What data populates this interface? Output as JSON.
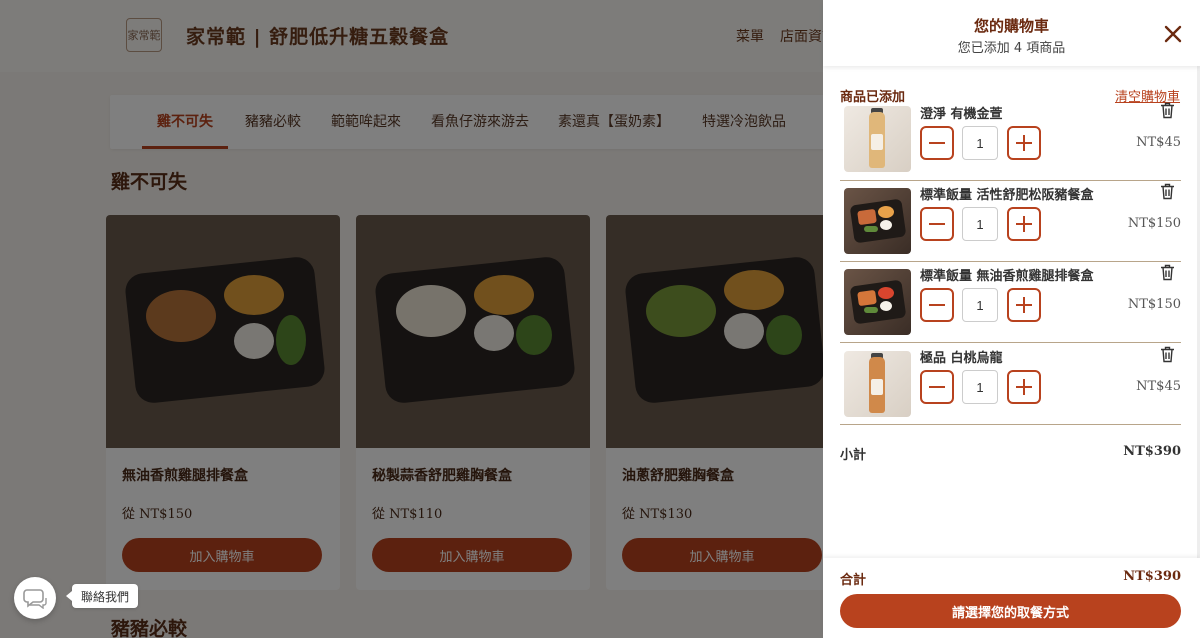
{
  "site": {
    "title": "家常範 | 舒肥低升糖五穀餐盒",
    "logo_text": "家常範",
    "nav": [
      "菜單",
      "店面資訊"
    ]
  },
  "category_tabs": [
    {
      "label": "雞不可失",
      "active": true
    },
    {
      "label": "豬豬必較",
      "active": false
    },
    {
      "label": "範範哞起來",
      "active": false
    },
    {
      "label": "看魚仔游來游去",
      "active": false
    },
    {
      "label": "素還真【蛋奶素】",
      "active": false
    },
    {
      "label": "特選冷泡飲品",
      "active": false
    }
  ],
  "sections": [
    {
      "title": "雞不可失",
      "products": [
        {
          "name": "無油香煎雞腿排餐盒",
          "price": "從 NT$150",
          "button": "加入購物車"
        },
        {
          "name": "秘製蒜香舒肥雞胸餐盒",
          "price": "從 NT$110",
          "button": "加入購物車"
        },
        {
          "name": "油蔥舒肥雞胸餐盒",
          "price": "從 NT$130",
          "button": "加入購物車"
        }
      ]
    },
    {
      "title": "豬豬必較"
    }
  ],
  "chat": {
    "tooltip": "聯絡我們",
    "icon": "chat-bubble-icon"
  },
  "cart": {
    "title": "您的購物車",
    "subtitle": "您已添加 4 項商品",
    "section_label": "商品已添加",
    "clear_label": "清空購物車",
    "items": [
      {
        "name": "澄淨 有機金萱",
        "qty": "1",
        "price": "NT$45",
        "thumb": "bottle",
        "liquid_color": "#e0b77a"
      },
      {
        "name": "標準飯量 活性舒肥松阪豬餐盒",
        "qty": "1",
        "price": "NT$150",
        "thumb": "bento"
      },
      {
        "name": "標準飯量 無油香煎雞腿排餐盒",
        "qty": "1",
        "price": "NT$150",
        "thumb": "bento"
      },
      {
        "name": "極品 白桃烏龍",
        "qty": "1",
        "price": "NT$45",
        "thumb": "bottle",
        "liquid_color": "#d0894a"
      }
    ],
    "subtotal_label": "小計",
    "subtotal": "NT$390",
    "total_label": "合計",
    "total": "NT$390",
    "checkout_label": "請選擇您的取餐方式"
  },
  "colors": {
    "accent": "#b8421e",
    "title_brown": "#6b2a10"
  }
}
